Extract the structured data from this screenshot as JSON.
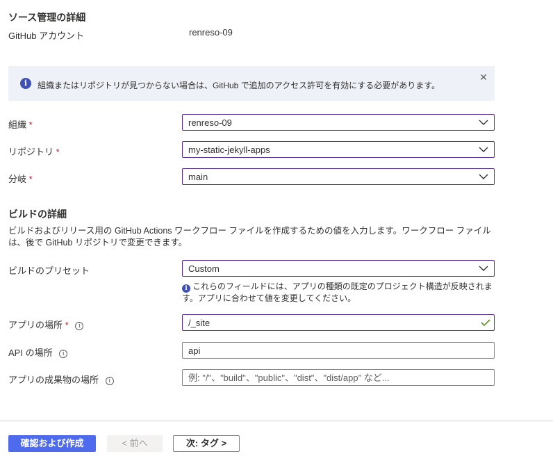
{
  "source": {
    "title": "ソース管理の詳細",
    "account_label": "GitHub アカウント",
    "account_value": "renreso-09"
  },
  "banner": {
    "text": "組織またはリポジトリが見つからない場合は、GitHub で追加のアクセス許可を有効にする必要があります。",
    "icon": "info-icon",
    "close_icon": "close-icon"
  },
  "org": {
    "label": "組織",
    "required": "*",
    "value": "renreso-09"
  },
  "repo": {
    "label": "リポジトリ",
    "required": "*",
    "value": "my-static-jekyll-apps"
  },
  "branch": {
    "label": "分岐",
    "required": "*",
    "value": "main"
  },
  "build": {
    "title": "ビルドの詳細",
    "description": "ビルドおよびリリース用の GitHub Actions ワークフロー ファイルを作成するための値を入力します。ワークフロー ファイルは、後で GitHub リポジトリで変更できます。",
    "preset_label": "ビルドのプリセット",
    "preset_value": "Custom",
    "preset_note": "これらのフィールドには、アプリの種類の既定のプロジェクト構造が反映されます。アプリに合わせて値を変更してください。",
    "app_location_label": "アプリの場所",
    "app_location_required": "*",
    "app_location_value": "/_site",
    "api_location_label": "API の場所",
    "api_location_value": "api",
    "output_location_label": "アプリの成果物の場所",
    "output_location_placeholder": "例: \"/\"、\"build\"、\"public\"、\"dist\"、\"dist/app\" など..."
  },
  "footer": {
    "review_create": "確認および作成",
    "previous": "< 前へ",
    "next": "次: タグ >"
  },
  "colors": {
    "accent": "#5c2d91",
    "primary_button": "#4f6bed",
    "banner_bg": "#eff1f8",
    "info_icon": "#3f51b5",
    "required": "#a4262c",
    "valid_check": "#498205"
  }
}
